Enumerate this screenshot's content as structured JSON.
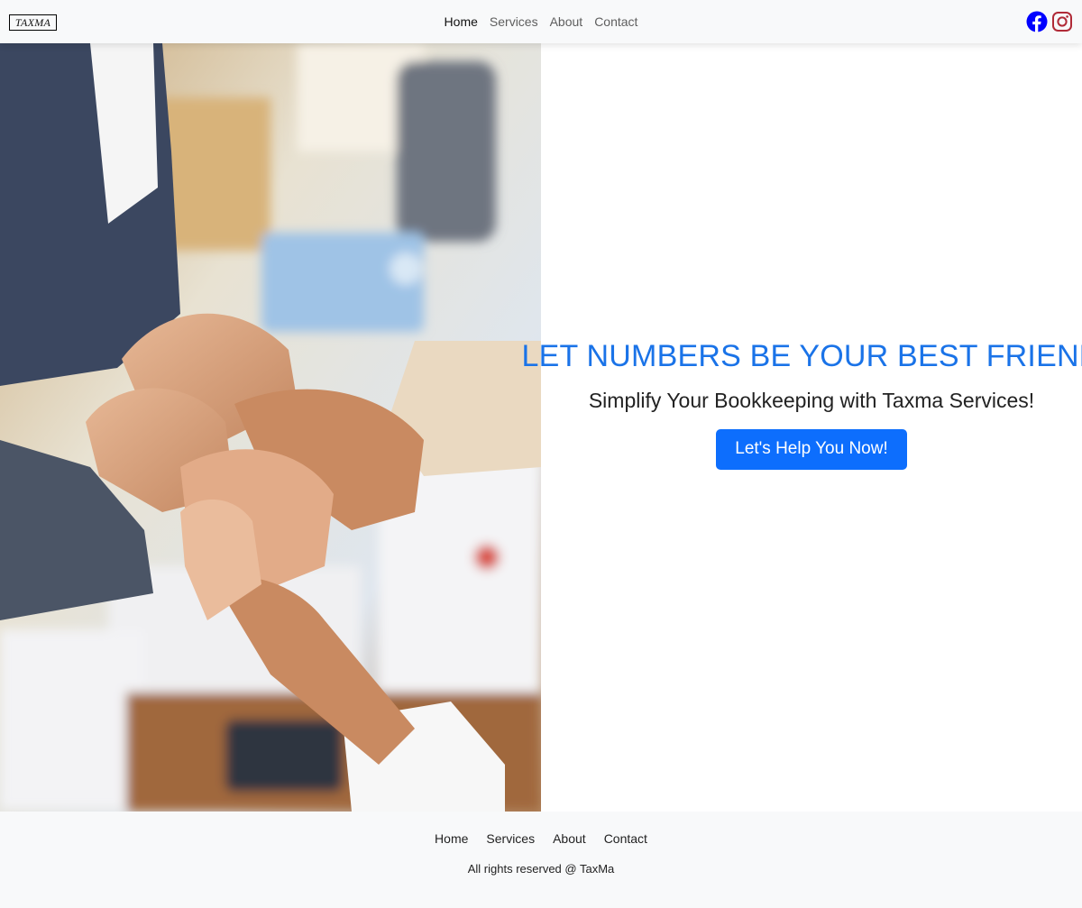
{
  "navbar": {
    "brand": "TAXMA",
    "links": [
      {
        "label": "Home"
      },
      {
        "label": "Services"
      },
      {
        "label": "About"
      },
      {
        "label": "Contact"
      }
    ],
    "active_link": "Home",
    "social": [
      {
        "icon": "facebook-icon",
        "color": "#0000ff"
      },
      {
        "icon": "instagram-icon",
        "color": "#b02a37"
      }
    ]
  },
  "hero": {
    "image": "teamwork-stacked-hands-photo",
    "headline": "LET NUMBERS BE YOUR BEST FRIEND",
    "subheadline": "Simplify Your Bookkeeping with Taxma Services!",
    "cta_label": "Let's Help You Now!",
    "accent_color": "#1a73e8",
    "button_color": "#0d6efd"
  },
  "footer": {
    "links": [
      {
        "label": "Home"
      },
      {
        "label": "Services"
      },
      {
        "label": "About"
      },
      {
        "label": "Contact"
      }
    ],
    "copyright": "All rights reserved @ TaxMa"
  }
}
